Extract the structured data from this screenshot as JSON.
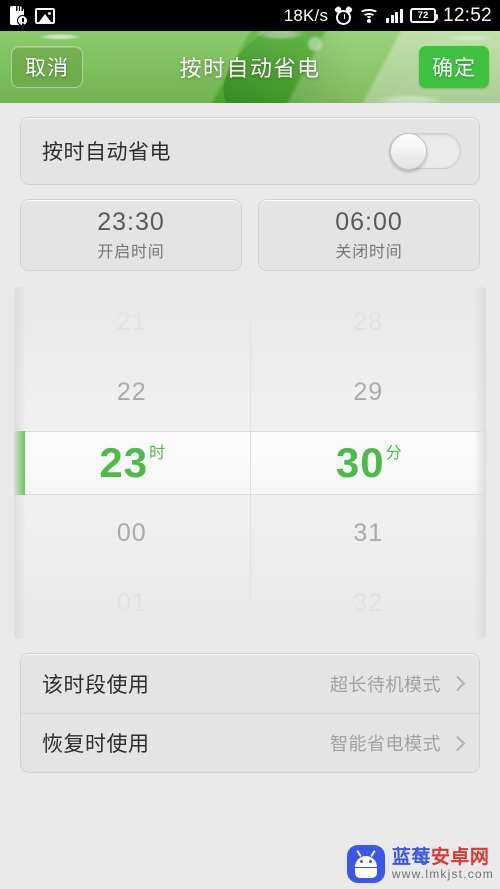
{
  "status_bar": {
    "icons_left": [
      "sdcard-warning-icon",
      "photo-icon"
    ],
    "network_speed": "18K/s",
    "icons_right": [
      "alarm-icon",
      "wifi-icon",
      "signal-icon"
    ],
    "battery_level": "72",
    "clock": "12:52"
  },
  "header": {
    "cancel_label": "取消",
    "title": "按时自动省电",
    "confirm_label": "确定",
    "confirm_color": "#3fc23f"
  },
  "toggle_card": {
    "label": "按时自动省电",
    "state": "off"
  },
  "time_cards": [
    {
      "value": "23:30",
      "caption": "开启时间"
    },
    {
      "value": "06:00",
      "caption": "关闭时间"
    }
  ],
  "picker": {
    "accent_color": "#58c94a",
    "hours": {
      "items": [
        "21",
        "22",
        "23",
        "00",
        "01"
      ],
      "selected_index": 2,
      "selected_value": "23",
      "unit": "时"
    },
    "minutes": {
      "items": [
        "28",
        "29",
        "30",
        "31",
        "32"
      ],
      "selected_index": 2,
      "selected_value": "30",
      "unit": "分"
    }
  },
  "options": [
    {
      "label": "该时段使用",
      "value": "超长待机模式",
      "chevron": "chevron-right-icon"
    },
    {
      "label": "恢复时使用",
      "value": "智能省电模式",
      "chevron": "chevron-right-icon"
    }
  ],
  "watermark": {
    "title_part1": "蓝莓",
    "title_part2": "安卓网",
    "url": "www.lmkjst.com"
  }
}
